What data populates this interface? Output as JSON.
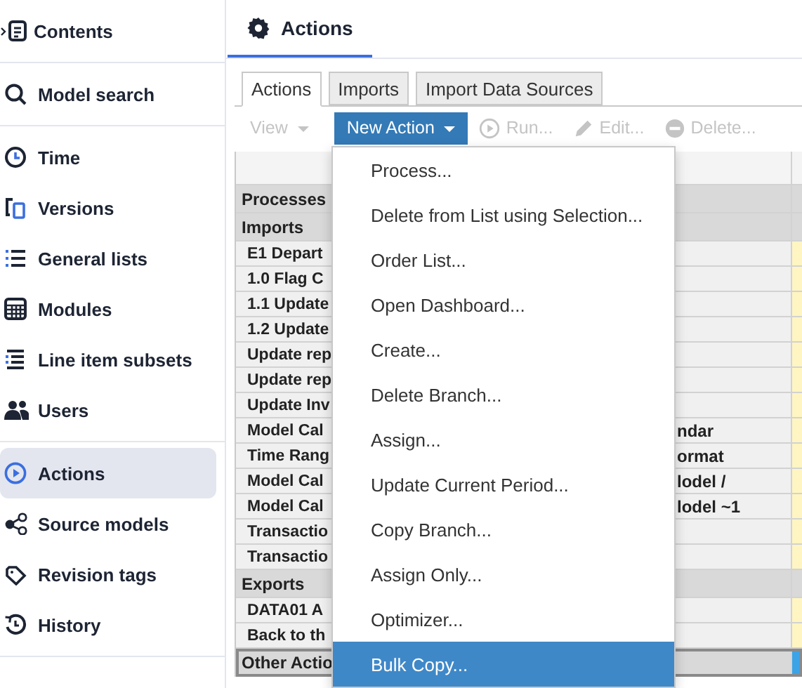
{
  "sidebar": {
    "groups": [
      [
        {
          "label": "Contents",
          "selected": false
        }
      ],
      [
        {
          "label": "Model search",
          "selected": false
        }
      ],
      [
        {
          "label": "Time",
          "selected": false
        },
        {
          "label": "Versions",
          "selected": false
        },
        {
          "label": "General lists",
          "selected": false
        },
        {
          "label": "Modules",
          "selected": false
        },
        {
          "label": "Line item subsets",
          "selected": false
        },
        {
          "label": "Users",
          "selected": false
        }
      ],
      [
        {
          "label": "Actions",
          "selected": true
        },
        {
          "label": "Source models",
          "selected": false
        },
        {
          "label": "Revision tags",
          "selected": false
        },
        {
          "label": "History",
          "selected": false
        }
      ]
    ]
  },
  "page_tab": {
    "label": "Actions",
    "selected": true
  },
  "tabs": [
    {
      "label": "Actions",
      "selected": true
    },
    {
      "label": "Imports",
      "selected": false
    },
    {
      "label": "Import Data Sources",
      "selected": false
    }
  ],
  "toolbar": [
    {
      "kind": "view",
      "label": "View",
      "disabled": true
    },
    {
      "kind": "new",
      "label": "New Action",
      "disabled": false
    },
    {
      "kind": "run",
      "label": "Run...",
      "disabled": true
    },
    {
      "kind": "edit",
      "label": "Edit...",
      "disabled": true
    },
    {
      "kind": "delete",
      "label": "Delete...",
      "disabled": true
    }
  ],
  "grid": {
    "rows": [
      {
        "kind": "group",
        "label": "Processes",
        "selected": false
      },
      {
        "kind": "group",
        "label": "Imports",
        "selected": false
      },
      {
        "kind": "item",
        "cells": [
          "E1 Depart"
        ],
        "selected": false
      },
      {
        "kind": "item",
        "cells": [
          "1.0 Flag C"
        ],
        "selected": false
      },
      {
        "kind": "item",
        "cells": [
          "1.1 Update"
        ],
        "selected": false
      },
      {
        "kind": "item",
        "cells": [
          "1.2 Update"
        ],
        "selected": false
      },
      {
        "kind": "item",
        "cells": [
          "Update rep"
        ],
        "selected": false
      },
      {
        "kind": "item",
        "cells": [
          "Update rep"
        ],
        "selected": false
      },
      {
        "kind": "item",
        "cells": [
          "Update Inv"
        ],
        "selected": false
      },
      {
        "kind": "item",
        "cells": [
          "Model Cal",
          "ndar"
        ],
        "selected": false
      },
      {
        "kind": "item",
        "cells": [
          "Time Rang",
          "ormat"
        ],
        "selected": false
      },
      {
        "kind": "item",
        "cells": [
          "Model Cal",
          "lodel /"
        ],
        "selected": false
      },
      {
        "kind": "item",
        "cells": [
          "Model Cal",
          "lodel ~1"
        ],
        "selected": false
      },
      {
        "kind": "item",
        "cells": [
          "Transactio"
        ],
        "selected": false
      },
      {
        "kind": "item",
        "cells": [
          "Transactio"
        ],
        "selected": false
      },
      {
        "kind": "group",
        "label": "Exports",
        "selected": false
      },
      {
        "kind": "item",
        "cells": [
          "DATA01 A"
        ],
        "selected": false
      },
      {
        "kind": "item",
        "cells": [
          "Back to th"
        ],
        "selected": false
      },
      {
        "kind": "group",
        "label": "Other Actio",
        "selected": true
      }
    ]
  },
  "menu": {
    "items": [
      {
        "label": "Process...",
        "selected": false
      },
      {
        "label": "Delete from List using Selection...",
        "selected": false
      },
      {
        "label": "Order List...",
        "selected": false
      },
      {
        "label": "Open Dashboard...",
        "selected": false
      },
      {
        "label": "Create...",
        "selected": false
      },
      {
        "label": "Delete Branch...",
        "selected": false
      },
      {
        "label": "Assign...",
        "selected": false
      },
      {
        "label": "Update Current Period...",
        "selected": false
      },
      {
        "label": "Copy Branch...",
        "selected": false
      },
      {
        "label": "Assign Only...",
        "selected": false
      },
      {
        "label": "Optimizer...",
        "selected": false
      },
      {
        "label": "Bulk Copy...",
        "selected": true
      }
    ]
  }
}
